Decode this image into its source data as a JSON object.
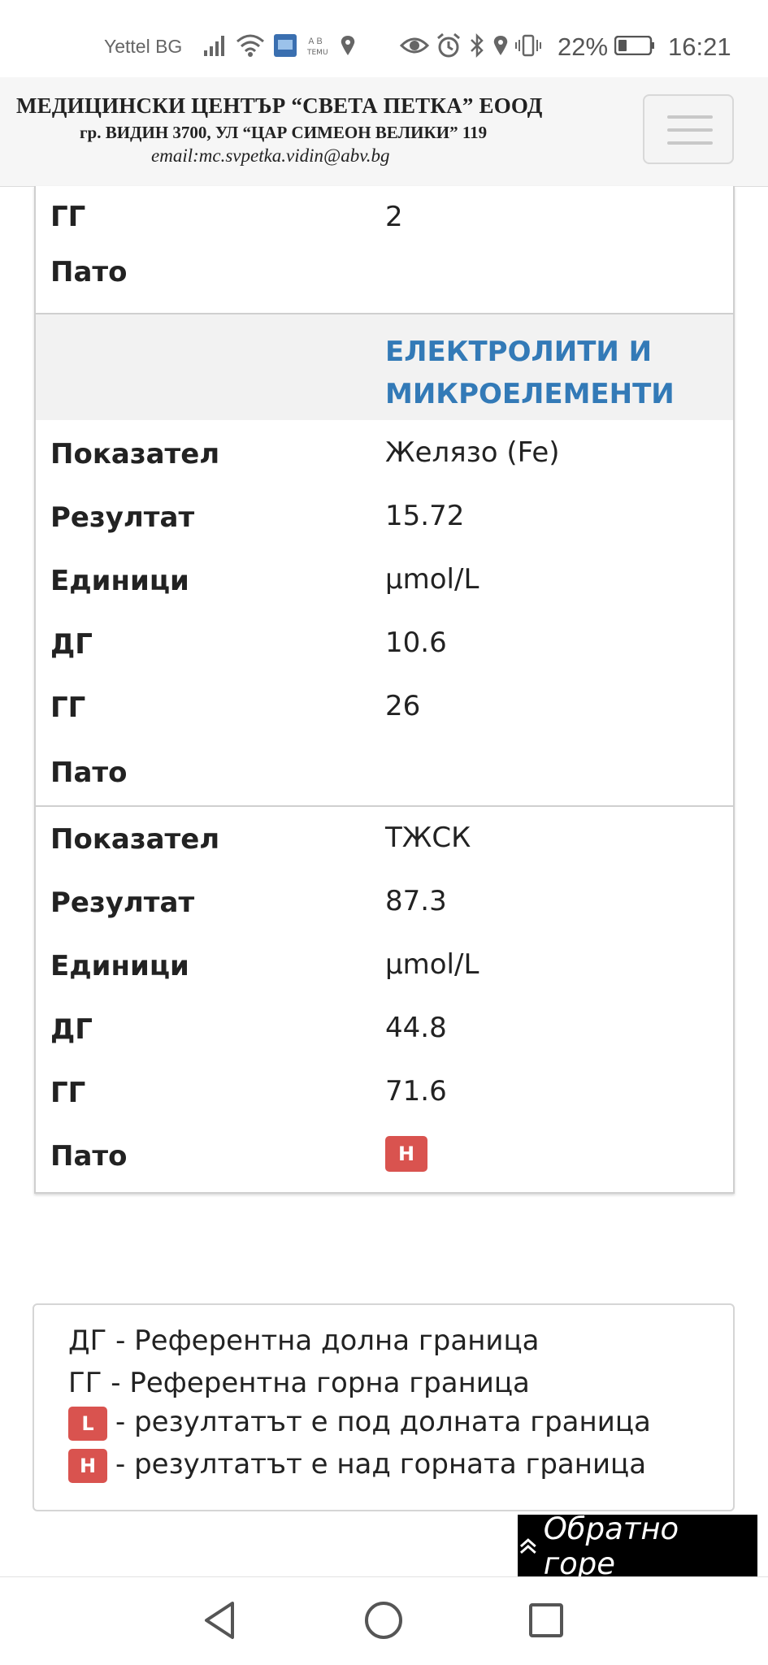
{
  "status_bar": {
    "carrier": "Yettel BG",
    "battery": "22%",
    "time": "16:21",
    "icons": [
      "signal-icon",
      "wifi-icon",
      "app-icon",
      "temu-icon",
      "location-icon",
      "eye-icon",
      "alarm-icon",
      "bluetooth-icon",
      "location-icon",
      "vibrate-icon",
      "battery-icon"
    ]
  },
  "header": {
    "line1": "МЕДИЦИНСКИ ЦЕНТЪР “СВЕТА ПЕТКА” ЕООД",
    "line2": "гр. ВИДИН 3700, УЛ “ЦАР СИМЕОН ВЕЛИКИ” 119",
    "line3": "email:mc.svpetka.vidin@abv.bg"
  },
  "labels": {
    "gg": "ГГ",
    "dg": "ДГ",
    "pato": "Пато",
    "pokazatel": "Показател",
    "rezultat": "Резултат",
    "edinici": "Единици"
  },
  "top_partial": {
    "gg": "2",
    "pato": ""
  },
  "section": {
    "title": "ЕЛЕКТРОЛИТИ И МИКРОЕЛЕМЕНТИ"
  },
  "records": [
    {
      "pokazatel": "Желязо (Fe)",
      "rezultat": "15.72",
      "edinici": "µmol/L",
      "dg": "10.6",
      "gg": "26",
      "pato": ""
    },
    {
      "pokazatel": "ТЖСК",
      "rezultat": "87.3",
      "edinici": "µmol/L",
      "dg": "44.8",
      "gg": "71.6",
      "pato": "H"
    }
  ],
  "legend": {
    "dg_line": "ДГ - Референтна долна граница",
    "gg_line": "ГГ - Референтна горна граница",
    "low_badge": "L",
    "low_text": "- резултатът е под долната граница",
    "high_badge": "H",
    "high_text": "- резултатът е над горната граница"
  },
  "back_to_top": "Обратно горе",
  "colors": {
    "section_title": "#337ab7",
    "badge": "#d9534f"
  }
}
